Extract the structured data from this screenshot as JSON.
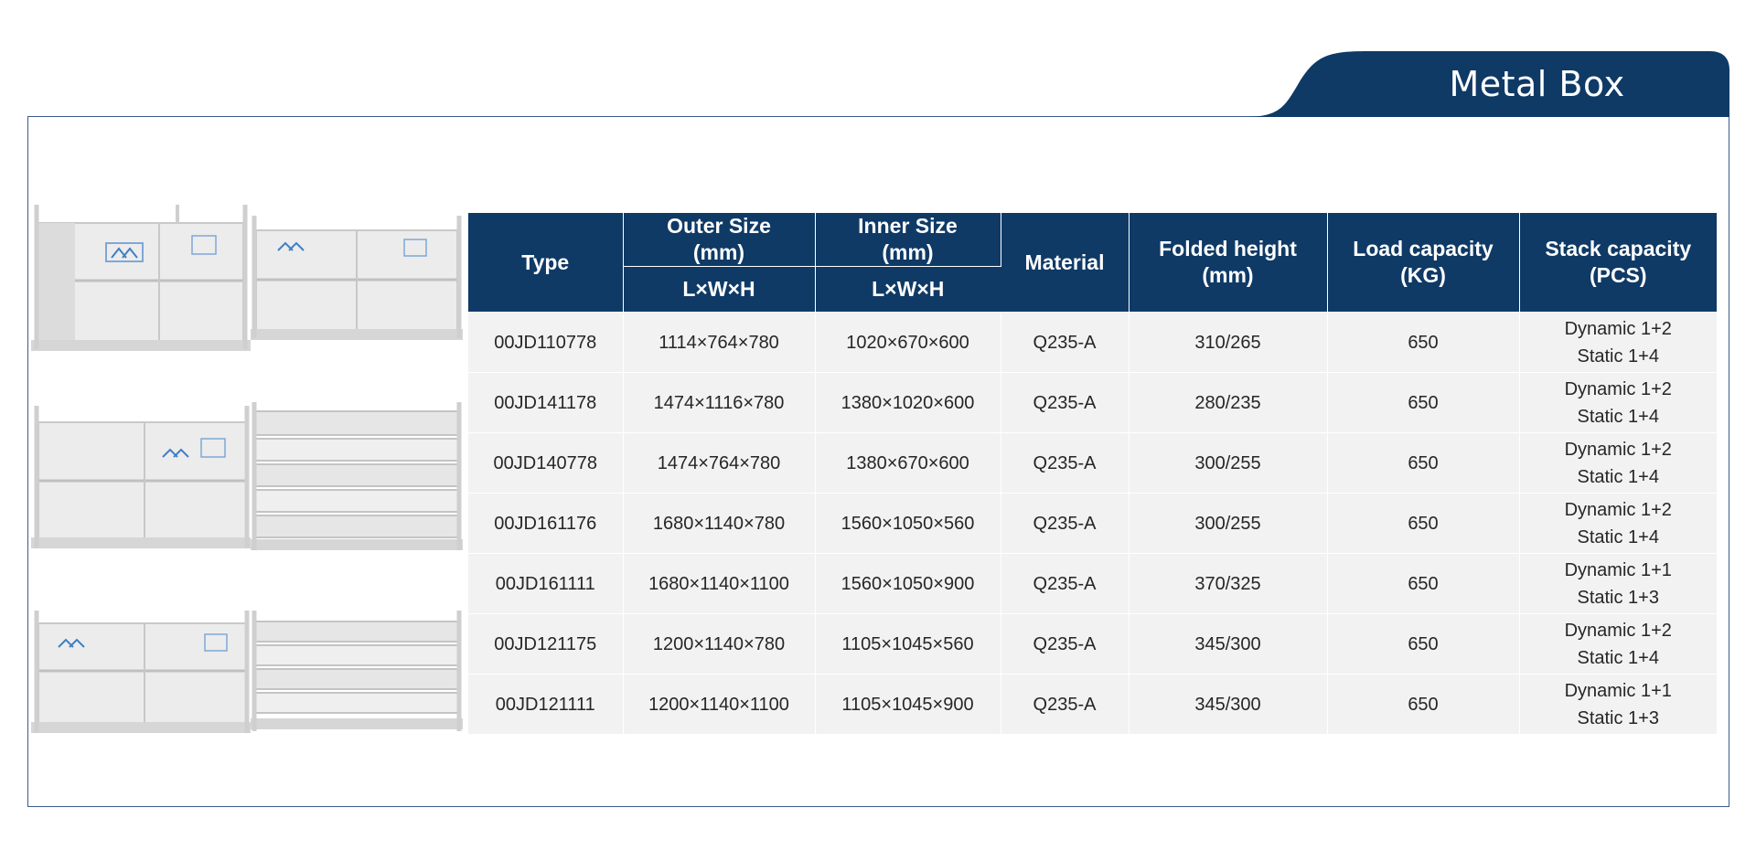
{
  "title": "Metal Box",
  "colors": {
    "header_bg": "#0f3a66",
    "frame_border": "#3d5a8a",
    "row_bg": "#f2f2f2"
  },
  "table": {
    "headers": {
      "type": "Type",
      "outer_size": [
        "Outer Size",
        "(mm)"
      ],
      "inner_size": [
        "Inner Size",
        "(mm)"
      ],
      "outer_sub": "L×W×H",
      "inner_sub": "L×W×H",
      "material": "Material",
      "folded_height": [
        "Folded height",
        "(mm)"
      ],
      "load_capacity": [
        "Load capacity",
        "(KG)"
      ],
      "stack_capacity": [
        "Stack capacity",
        "(PCS)"
      ]
    },
    "rows": [
      {
        "type": "00JD110778",
        "outer": "1114×764×780",
        "inner": "1020×670×600",
        "material": "Q235-A",
        "folded": "310/265",
        "load": "650",
        "stack": [
          "Dynamic 1+2",
          "Static 1+4"
        ]
      },
      {
        "type": "00JD141178",
        "outer": "1474×1116×780",
        "inner": "1380×1020×600",
        "material": "Q235-A",
        "folded": "280/235",
        "load": "650",
        "stack": [
          "Dynamic 1+2",
          "Static 1+4"
        ]
      },
      {
        "type": "00JD140778",
        "outer": "1474×764×780",
        "inner": "1380×670×600",
        "material": "Q235-A",
        "folded": "300/255",
        "load": "650",
        "stack": [
          "Dynamic 1+2",
          "Static 1+4"
        ]
      },
      {
        "type": "00JD161176",
        "outer": "1680×1140×780",
        "inner": "1560×1050×560",
        "material": "Q235-A",
        "folded": "300/255",
        "load": "650",
        "stack": [
          "Dynamic 1+2",
          "Static 1+4"
        ]
      },
      {
        "type": "00JD161111",
        "outer": "1680×1140×1100",
        "inner": "1560×1050×900",
        "material": "Q235-A",
        "folded": "370/325",
        "load": "650",
        "stack": [
          "Dynamic 1+1",
          "Static 1+3"
        ]
      },
      {
        "type": "00JD121175",
        "outer": "1200×1140×780",
        "inner": "1105×1045×560",
        "material": "Q235-A",
        "folded": "345/300",
        "load": "650",
        "stack": [
          "Dynamic 1+2",
          "Static 1+4"
        ]
      },
      {
        "type": "00JD121111",
        "outer": "1200×1140×1100",
        "inner": "1105×1045×900",
        "material": "Q235-A",
        "folded": "345/300",
        "load": "650",
        "stack": [
          "Dynamic 1+1",
          "Static 1+3"
        ]
      }
    ]
  }
}
